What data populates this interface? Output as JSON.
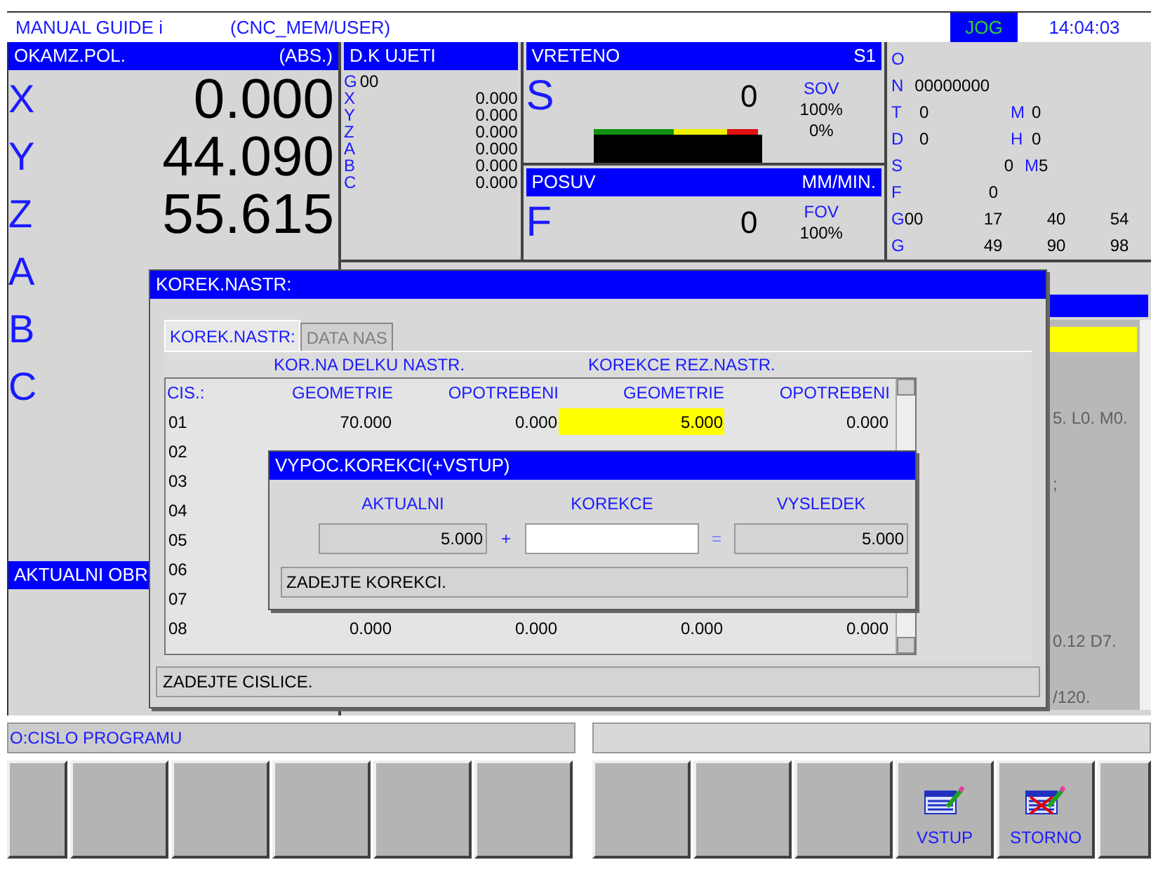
{
  "header": {
    "app": "MANUAL GUIDE i",
    "path": "(CNC_MEM/USER)",
    "mode": "JOG",
    "time": "14:04:03"
  },
  "position": {
    "title": "OKAMZ.POL.",
    "mode": "(ABS.)",
    "axes": [
      {
        "axis": "X",
        "value": "0.000"
      },
      {
        "axis": "Y",
        "value": "44.090"
      },
      {
        "axis": "Z",
        "value": "55.615"
      },
      {
        "axis": "A"
      },
      {
        "axis": "B"
      },
      {
        "axis": "C"
      }
    ]
  },
  "distance_to_go": {
    "title": "D.K UJETI",
    "g_key": "G",
    "g_value": "00",
    "axes": [
      {
        "axis": "X",
        "value": "0.000"
      },
      {
        "axis": "Y",
        "value": "0.000"
      },
      {
        "axis": "Z",
        "value": "0.000"
      },
      {
        "axis": "A",
        "value": "0.000"
      },
      {
        "axis": "B",
        "value": "0.000"
      },
      {
        "axis": "C",
        "value": "0.000"
      }
    ]
  },
  "spindle": {
    "title": "VRETENO",
    "unit": "S1",
    "letter": "S",
    "value": "0",
    "override_label": "SOV",
    "override": "100%",
    "load": "0%"
  },
  "feed": {
    "title": "POSUV",
    "unit": "MM/MIN.",
    "letter": "F",
    "value": "0",
    "override_label": "FOV",
    "override": "100%"
  },
  "modal_info": [
    {
      "kind": "single",
      "key": "O"
    },
    {
      "kind": "long",
      "key": "N",
      "value": "00000000"
    },
    {
      "kind": "pair",
      "key": "T",
      "value": "0",
      "key2": "M",
      "value2": "0"
    },
    {
      "kind": "pair",
      "key": "D",
      "value": "0",
      "key2": "H",
      "value2": "0"
    },
    {
      "kind": "spindle",
      "key": "S",
      "value": "0",
      "key2": "M",
      "value2": "5"
    },
    {
      "kind": "feed",
      "key": "F",
      "value": "0"
    },
    {
      "kind": "modal",
      "key": "G",
      "code": "00",
      "values": [
        "17",
        "40",
        "54"
      ]
    },
    {
      "kind": "modal",
      "key": "G",
      "values": [
        "49",
        "90",
        "98"
      ]
    }
  ],
  "current_panel": {
    "title": "AKTUALNI OBR"
  },
  "program_panel": {
    "lines": [
      "5. L0. M0.",
      ";",
      "0.12 D7.",
      "/120."
    ]
  },
  "offset_dialog": {
    "title": "KOREK.NASTR:",
    "tabs": [
      {
        "label": "KOREK.NASTR:",
        "selected": true
      },
      {
        "label": "DATA NAS",
        "selected": false
      }
    ],
    "groups": [
      "KOR.NA DELKU NASTR.",
      "KOREKCE REZ.NASTR."
    ],
    "columns": [
      "CIS.:",
      "GEOMETRIE",
      "OPOTREBENI",
      "GEOMETRIE",
      "OPOTREBENI"
    ],
    "rows": [
      {
        "number": "01",
        "cells": [
          {
            "text": "70.000",
            "selected": false
          },
          {
            "text": "0.000",
            "selected": false
          },
          {
            "text": "5.000",
            "selected": true
          },
          {
            "text": "0.000",
            "selected": false
          }
        ]
      },
      {
        "number": "02"
      },
      {
        "number": "03"
      },
      {
        "number": "04"
      },
      {
        "number": "05"
      },
      {
        "number": "06"
      },
      {
        "number": "07"
      },
      {
        "number": "08",
        "cells": [
          {
            "text": "0.000",
            "selected": false
          },
          {
            "text": "0.000",
            "selected": false
          },
          {
            "text": "0.000",
            "selected": false
          },
          {
            "text": "0.000",
            "selected": false
          }
        ]
      }
    ],
    "message": "ZADEJTE CISLICE."
  },
  "calc_dialog": {
    "title": "VYPOC.KOREKCI(+VSTUP)",
    "labels": [
      "AKTUALNI",
      "KOREKCE",
      "VYSLEDEK"
    ],
    "current": "5.000",
    "plus": "+",
    "equals": "=",
    "result": "5.000",
    "message": "ZADEJTE KOREKCI."
  },
  "message_bar": {
    "text": "O:CISLO PROGRAMU"
  },
  "softkeys_left": [
    {
      "kind": "blank"
    },
    {
      "kind": "blank"
    },
    {
      "kind": "blank"
    },
    {
      "kind": "blank"
    },
    {
      "kind": "blank"
    },
    {
      "kind": "blank"
    }
  ],
  "softkeys_right": [
    {
      "kind": "blank"
    },
    {
      "kind": "blank"
    },
    {
      "kind": "blank"
    },
    {
      "kind": "input",
      "label": "VSTUP"
    },
    {
      "kind": "cancel",
      "label": "STORNO"
    },
    {
      "kind": "blank"
    }
  ]
}
